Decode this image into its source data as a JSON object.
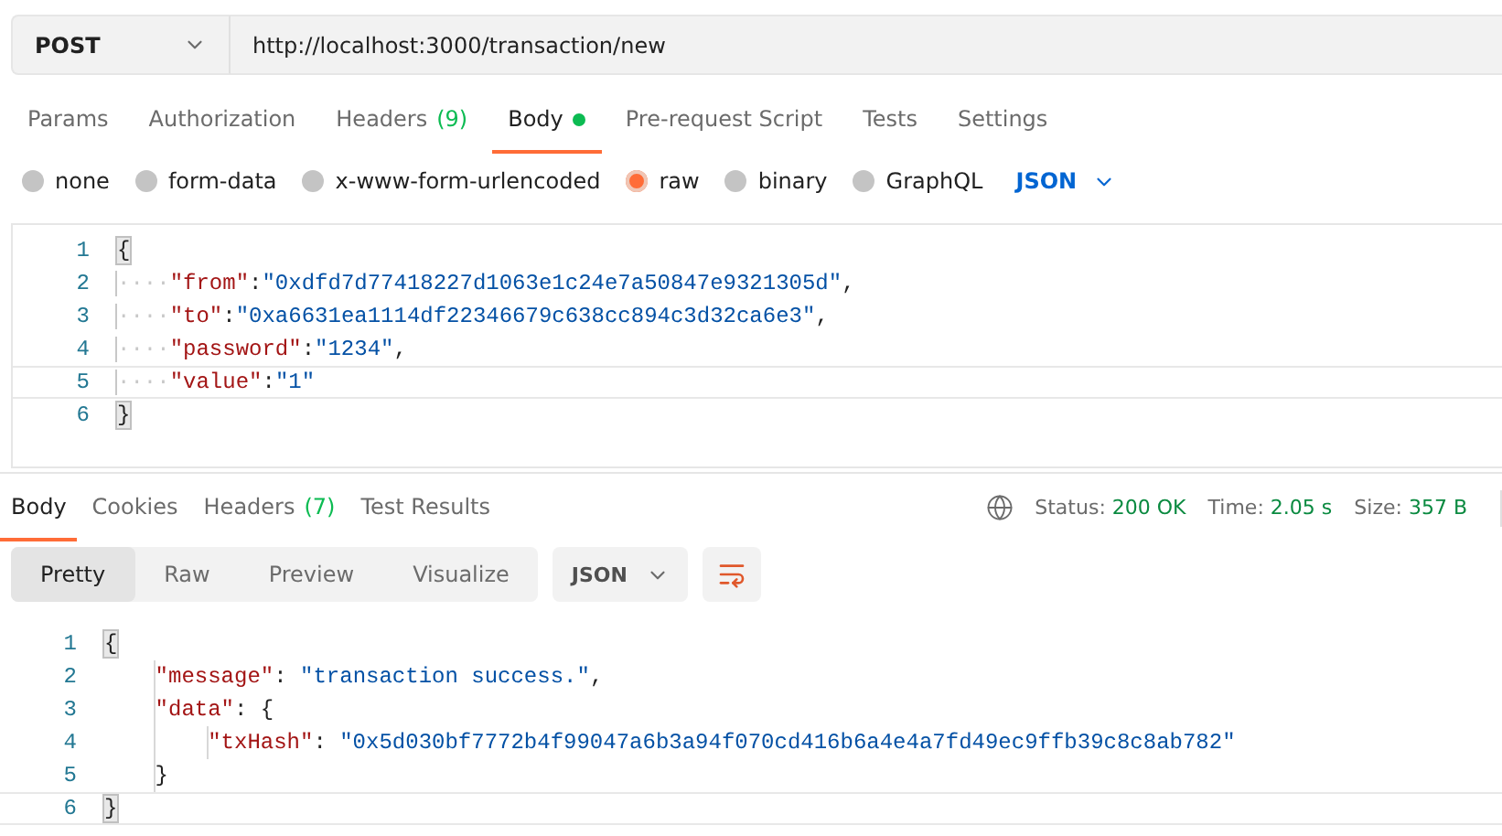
{
  "request": {
    "method": "POST",
    "url": "http://localhost:3000/transaction/new"
  },
  "request_tabs": [
    {
      "label": "Params",
      "selected": false,
      "indicator": false
    },
    {
      "label": "Authorization",
      "selected": false,
      "indicator": false
    },
    {
      "label": "Headers",
      "count": "(9)",
      "selected": false,
      "indicator": false
    },
    {
      "label": "Body",
      "selected": true,
      "indicator": true
    },
    {
      "label": "Pre-request Script",
      "selected": false,
      "indicator": false
    },
    {
      "label": "Tests",
      "selected": false,
      "indicator": false
    },
    {
      "label": "Settings",
      "selected": false,
      "indicator": false
    }
  ],
  "body_types": [
    {
      "label": "none",
      "selected": false
    },
    {
      "label": "form-data",
      "selected": false
    },
    {
      "label": "x-www-form-urlencoded",
      "selected": false
    },
    {
      "label": "raw",
      "selected": true
    },
    {
      "label": "binary",
      "selected": false
    },
    {
      "label": "GraphQL",
      "selected": false
    }
  ],
  "body_format": "JSON",
  "request_body": [
    {
      "number": "1",
      "current": false,
      "tokens": [
        {
          "kind": "match",
          "text": "{"
        }
      ]
    },
    {
      "number": "2",
      "current": false,
      "tokens": [
        {
          "kind": "indent",
          "text": "····"
        },
        {
          "kind": "key",
          "text": "\"from\""
        },
        {
          "kind": "punct",
          "text": ":"
        },
        {
          "kind": "string",
          "text": "\"0xdfd7d77418227d1063e1c24e7a50847e9321305d\""
        },
        {
          "kind": "punct",
          "text": ","
        }
      ]
    },
    {
      "number": "3",
      "current": false,
      "tokens": [
        {
          "kind": "indent",
          "text": "····"
        },
        {
          "kind": "key",
          "text": "\"to\""
        },
        {
          "kind": "punct",
          "text": ":"
        },
        {
          "kind": "string",
          "text": "\"0xa6631ea1114df22346679c638cc894c3d32ca6e3\""
        },
        {
          "kind": "punct",
          "text": ","
        }
      ]
    },
    {
      "number": "4",
      "current": false,
      "tokens": [
        {
          "kind": "indent",
          "text": "····"
        },
        {
          "kind": "key",
          "text": "\"password\""
        },
        {
          "kind": "punct",
          "text": ":"
        },
        {
          "kind": "string",
          "text": "\"1234\""
        },
        {
          "kind": "punct",
          "text": ","
        }
      ]
    },
    {
      "number": "5",
      "current": true,
      "tokens": [
        {
          "kind": "indent",
          "text": "····"
        },
        {
          "kind": "key",
          "text": "\"value\""
        },
        {
          "kind": "punct",
          "text": ":"
        },
        {
          "kind": "string",
          "text": "\"1\""
        }
      ]
    },
    {
      "number": "6",
      "current": false,
      "tokens": [
        {
          "kind": "match",
          "text": "}"
        }
      ]
    }
  ],
  "response_tabs": [
    {
      "label": "Body",
      "selected": true
    },
    {
      "label": "Cookies",
      "selected": false
    },
    {
      "label": "Headers",
      "count": "(7)",
      "selected": false
    },
    {
      "label": "Test Results",
      "selected": false
    }
  ],
  "status": [
    {
      "label": "Status:",
      "value": "200 OK"
    },
    {
      "label": "Time:",
      "value": "2.05 s"
    },
    {
      "label": "Size:",
      "value": "357 B"
    }
  ],
  "view_modes": [
    {
      "label": "Pretty",
      "selected": true
    },
    {
      "label": "Raw",
      "selected": false
    },
    {
      "label": "Preview",
      "selected": false
    },
    {
      "label": "Visualize",
      "selected": false
    }
  ],
  "response_format": "JSON",
  "response_body": [
    {
      "number": "1",
      "current": false,
      "tokens": [
        {
          "kind": "match",
          "text": "{"
        }
      ],
      "children": [
        {
          "number": "2",
          "current": false,
          "tokens": [
            {
              "kind": "key",
              "text": "\"message\""
            },
            {
              "kind": "punct",
              "text": ": "
            },
            {
              "kind": "string",
              "text": "\"transaction success.\""
            },
            {
              "kind": "punct",
              "text": ","
            }
          ]
        },
        {
          "number": "3",
          "current": false,
          "tokens": [
            {
              "kind": "key",
              "text": "\"data\""
            },
            {
              "kind": "punct",
              "text": ": {"
            }
          ],
          "children": [
            {
              "number": "4",
              "current": false,
              "tokens": [
                {
                  "kind": "key",
                  "text": "\"txHash\""
                },
                {
                  "kind": "punct",
                  "text": ": "
                },
                {
                  "kind": "string",
                  "text": "\"0x5d030bf7772b4f99047a6b3a94f070cd416b6a4e4a7fd49ec9ffb39c8c8ab782\""
                }
              ]
            }
          ]
        },
        {
          "number": "5",
          "current": false,
          "tokens": [
            {
              "kind": "punct",
              "text": "}"
            }
          ]
        }
      ]
    },
    {
      "number": "6",
      "current": true,
      "tokens": [
        {
          "kind": "match",
          "text": "}"
        }
      ]
    }
  ]
}
